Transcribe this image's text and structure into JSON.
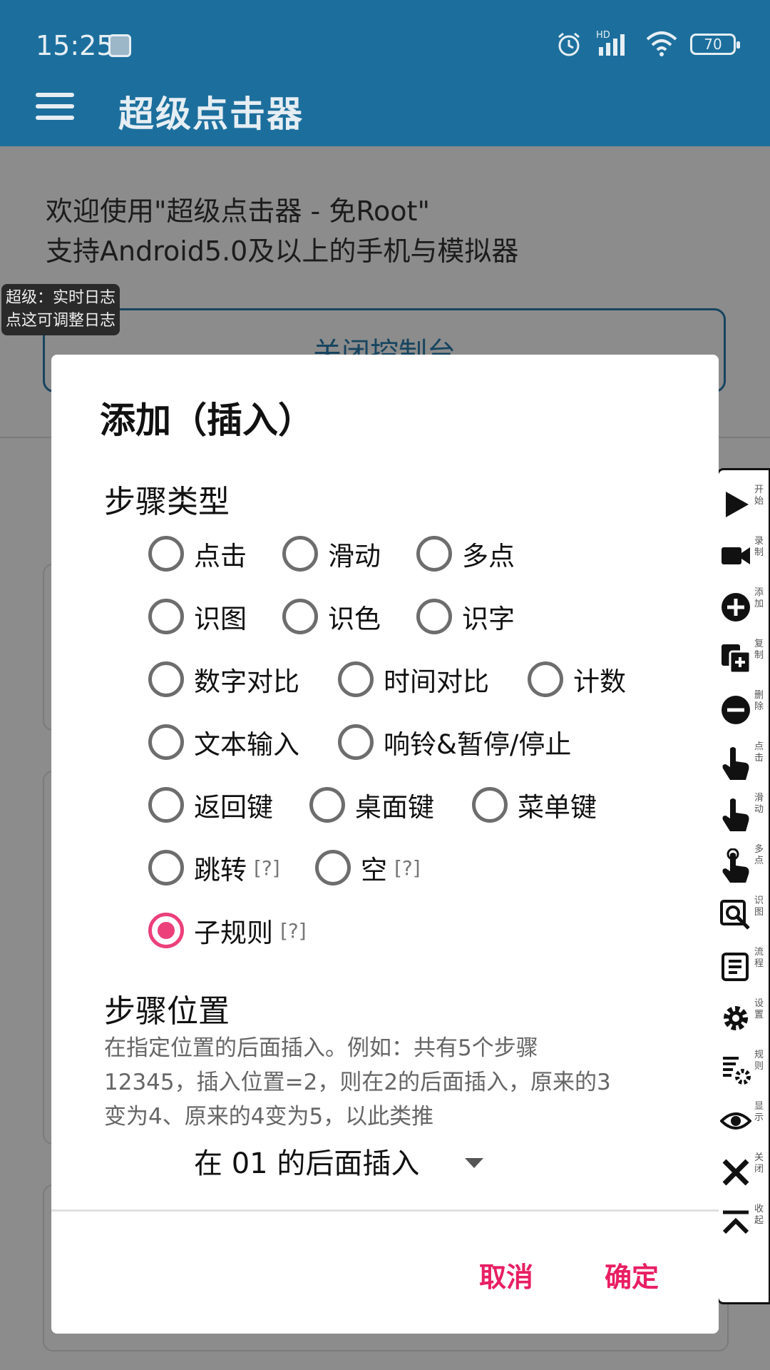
{
  "status_bar": {
    "time": "15:25",
    "hd": "HD",
    "battery": "70"
  },
  "app_bar": {
    "title": "超级点击器"
  },
  "main": {
    "welcome_line1": "欢迎使用\"超级点击器 - 免Root\"",
    "welcome_line2": "支持Android5.0及以上的手机与模拟器",
    "console_button": "关闭控制台",
    "log_overlay_line1": "超级：实时日志",
    "log_overlay_line2": "点这可调整日志"
  },
  "side_panel": {
    "items": [
      {
        "label": "开始",
        "icon": "play-icon"
      },
      {
        "label": "录制",
        "icon": "record-icon"
      },
      {
        "label": "添加",
        "icon": "add-icon"
      },
      {
        "label": "复制",
        "icon": "copy-icon"
      },
      {
        "label": "删除",
        "icon": "delete-icon"
      },
      {
        "label": "点击",
        "icon": "tap-icon"
      },
      {
        "label": "滑动",
        "icon": "swipe-icon"
      },
      {
        "label": "多点",
        "icon": "multi-touch-icon"
      },
      {
        "label": "识图",
        "icon": "image-search-icon"
      },
      {
        "label": "流程",
        "icon": "flow-icon"
      },
      {
        "label": "设置",
        "icon": "gear-icon"
      },
      {
        "label": "规则",
        "icon": "rules-icon"
      },
      {
        "label": "显示",
        "icon": "eye-icon"
      },
      {
        "label": "关闭",
        "icon": "close-icon"
      },
      {
        "label": "收起",
        "icon": "collapse-icon"
      }
    ]
  },
  "dialog": {
    "title": "添加（插入）",
    "step_type_title": "步骤类型",
    "options": {
      "click": "点击",
      "swipe": "滑动",
      "multi": "多点",
      "recognize_image": "识图",
      "recognize_color": "识色",
      "recognize_text": "识字",
      "number_compare": "数字对比",
      "time_compare": "时间对比",
      "count": "计数",
      "text_input": "文本输入",
      "ring_pause": "响铃&暂停/停止",
      "back_key": "返回键",
      "home_key": "桌面键",
      "menu_key": "菜单键",
      "jump": "跳转",
      "empty": "空",
      "sub_rule": "子规则"
    },
    "help_mark": "[?]",
    "selected_option": "子规则",
    "step_position_title": "步骤位置",
    "position_desc_line1": "在指定位置的后面插入。例如：共有5个步骤",
    "position_desc_line2": "12345，插入位置=2，则在2的后面插入，原来的3",
    "position_desc_line3": "变为4、原来的4变为5，以此类推",
    "position_value": "在 01 的后面插入",
    "cancel": "取消",
    "confirm": "确定"
  },
  "colors": {
    "app_bar": "#1c6f9d",
    "accent": "#e91e63",
    "radio_checked": "#ec407a"
  }
}
